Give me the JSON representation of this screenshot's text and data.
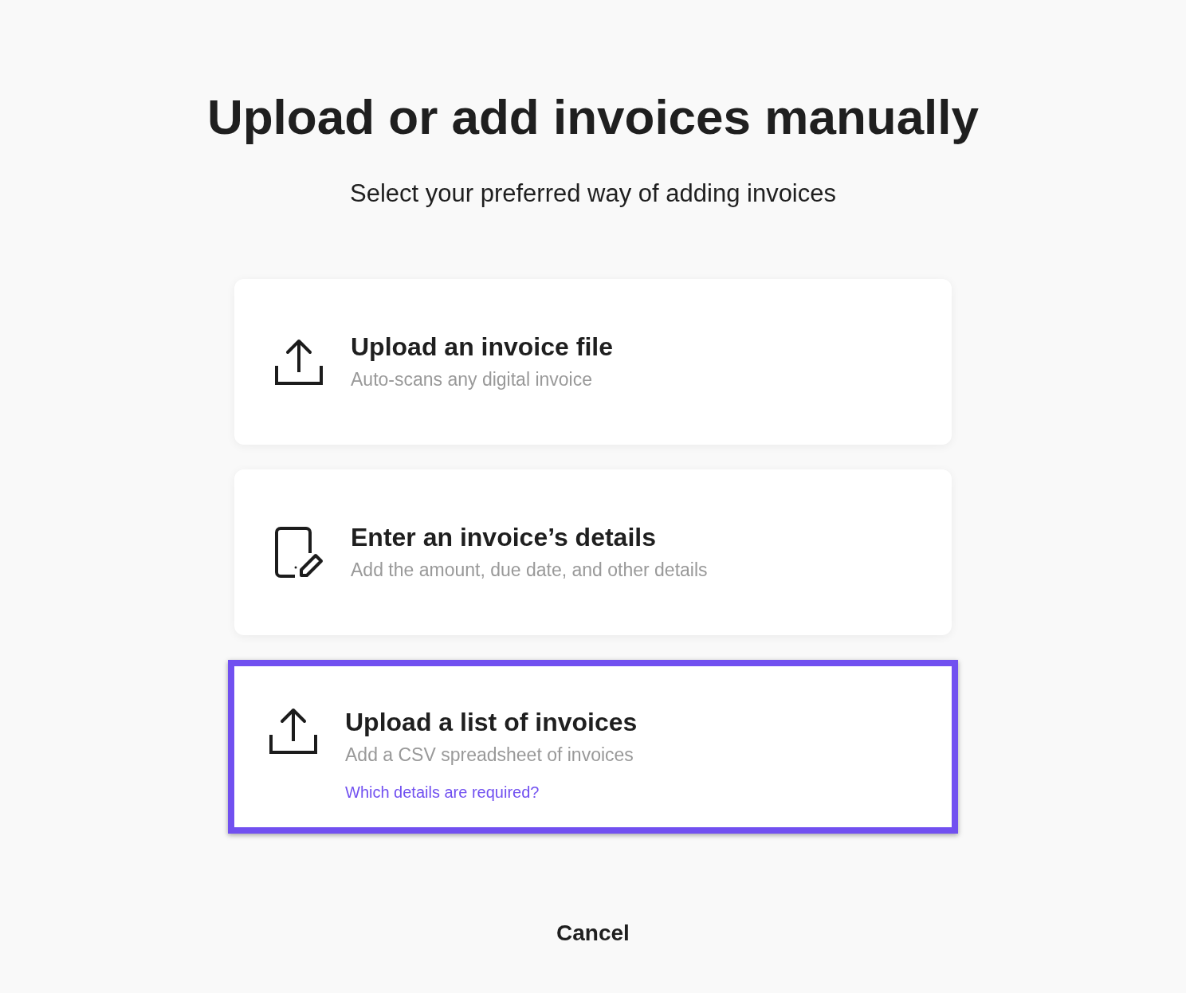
{
  "title": "Upload or add invoices manually",
  "subtitle": "Select your preferred way of adding invoices",
  "options": [
    {
      "kind": "upload",
      "title": "Upload an invoice file",
      "description": "Auto-scans any digital invoice",
      "selected": false
    },
    {
      "kind": "form",
      "title": "Enter an invoice’s details",
      "description": "Add the amount, due date, and other details",
      "selected": false
    },
    {
      "kind": "upload",
      "title": "Upload a list of invoices",
      "description": "Add a CSV spreadsheet of invoices",
      "link": "Which details are required?",
      "selected": true
    }
  ],
  "cancel": "Cancel"
}
